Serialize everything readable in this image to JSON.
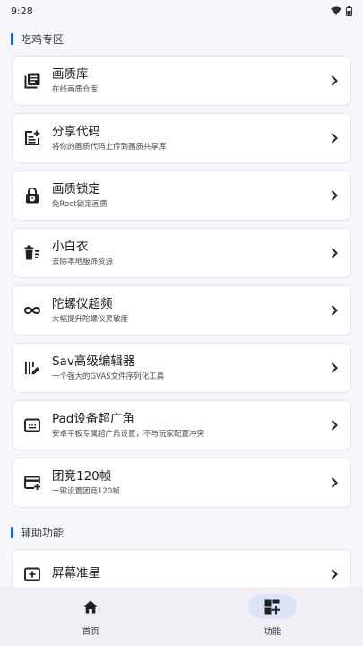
{
  "status_bar": {
    "time": "9:28"
  },
  "sections": {
    "pubg": {
      "title": "吃鸡专区",
      "items": [
        {
          "title": "画质库",
          "subtitle": "在线画质仓库",
          "icon": "library-icon"
        },
        {
          "title": "分享代码",
          "subtitle": "将你的画质代码上传到画质共享库",
          "icon": "post-add-icon"
        },
        {
          "title": "画质锁定",
          "subtitle": "免Root锁定画质",
          "icon": "lock-clock-icon"
        },
        {
          "title": "小白衣",
          "subtitle": "去除本地服饰资源",
          "icon": "delete-sweep-icon"
        },
        {
          "title": "陀螺仪超频",
          "subtitle": "大幅提升陀螺仪灵敏度",
          "icon": "infinity-icon"
        },
        {
          "title": "Sav高级编辑器",
          "subtitle": "一个强大的GVAS文件序列化工具",
          "icon": "edit-attributes-icon"
        },
        {
          "title": "Pad设备超广角",
          "subtitle": "安卓平板专属超广角设置，不与玩家配置冲突",
          "icon": "screen-ratio-icon"
        },
        {
          "title": "团竞120帧",
          "subtitle": "一键设置团竞120帧",
          "icon": "add-card-icon"
        }
      ]
    },
    "assist": {
      "title": "辅助功能",
      "items": [
        {
          "title": "屏幕准星",
          "subtitle": "",
          "icon": "crosshair-box-icon"
        }
      ]
    }
  },
  "bottom_nav": {
    "items": [
      {
        "label": "首页",
        "icon": "home-icon",
        "active": false
      },
      {
        "label": "功能",
        "icon": "dashboard-add-icon",
        "active": true
      }
    ]
  },
  "colors": {
    "accent": "#1a64d8",
    "background": "#f6f7fb",
    "nav_background": "#f1eef6",
    "nav_active_pill": "#dde3f6"
  }
}
